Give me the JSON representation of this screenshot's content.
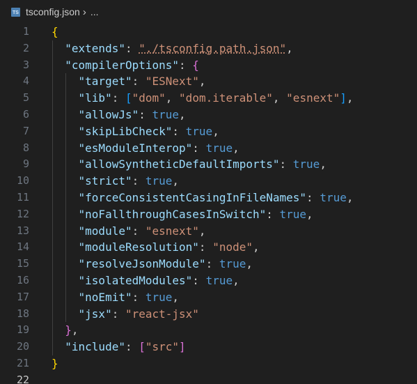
{
  "breadcrumb": {
    "icon_label": "TS",
    "file": "tsconfig.json",
    "separator": "›",
    "more": "..."
  },
  "colors": {
    "background": "#1f1f1f",
    "key": "#9cdcfe",
    "string": "#ce9178",
    "keyword": "#569cd6",
    "bracket_level1": "#ffd700",
    "bracket_level2": "#da70d6",
    "bracket_level3": "#179fff"
  },
  "lines": [
    {
      "n": "1",
      "tokens": [
        {
          "t": "{",
          "c": "b1"
        }
      ]
    },
    {
      "n": "2",
      "tokens": [
        {
          "t": "  "
        },
        {
          "t": "\"extends\"",
          "c": "key"
        },
        {
          "t": ": "
        },
        {
          "t": "\"./tsconfig.path.json\"",
          "c": "str underline"
        },
        {
          "t": ","
        }
      ]
    },
    {
      "n": "3",
      "tokens": [
        {
          "t": "  "
        },
        {
          "t": "\"compilerOptions\"",
          "c": "key"
        },
        {
          "t": ": "
        },
        {
          "t": "{",
          "c": "b2"
        }
      ]
    },
    {
      "n": "4",
      "tokens": [
        {
          "t": "    "
        },
        {
          "t": "\"target\"",
          "c": "key"
        },
        {
          "t": ": "
        },
        {
          "t": "\"ESNext\"",
          "c": "str"
        },
        {
          "t": ","
        }
      ]
    },
    {
      "n": "5",
      "tokens": [
        {
          "t": "    "
        },
        {
          "t": "\"lib\"",
          "c": "key"
        },
        {
          "t": ": "
        },
        {
          "t": "[",
          "c": "b3"
        },
        {
          "t": "\"dom\"",
          "c": "str"
        },
        {
          "t": ", "
        },
        {
          "t": "\"dom.iterable\"",
          "c": "str"
        },
        {
          "t": ", "
        },
        {
          "t": "\"esnext\"",
          "c": "str"
        },
        {
          "t": "]",
          "c": "b3"
        },
        {
          "t": ","
        }
      ]
    },
    {
      "n": "6",
      "tokens": [
        {
          "t": "    "
        },
        {
          "t": "\"allowJs\"",
          "c": "key"
        },
        {
          "t": ": "
        },
        {
          "t": "true",
          "c": "kw"
        },
        {
          "t": ","
        }
      ]
    },
    {
      "n": "7",
      "tokens": [
        {
          "t": "    "
        },
        {
          "t": "\"skipLibCheck\"",
          "c": "key"
        },
        {
          "t": ": "
        },
        {
          "t": "true",
          "c": "kw"
        },
        {
          "t": ","
        }
      ]
    },
    {
      "n": "8",
      "tokens": [
        {
          "t": "    "
        },
        {
          "t": "\"esModuleInterop\"",
          "c": "key"
        },
        {
          "t": ": "
        },
        {
          "t": "true",
          "c": "kw"
        },
        {
          "t": ","
        }
      ]
    },
    {
      "n": "9",
      "tokens": [
        {
          "t": "    "
        },
        {
          "t": "\"allowSyntheticDefaultImports\"",
          "c": "key"
        },
        {
          "t": ": "
        },
        {
          "t": "true",
          "c": "kw"
        },
        {
          "t": ","
        }
      ]
    },
    {
      "n": "10",
      "tokens": [
        {
          "t": "    "
        },
        {
          "t": "\"strict\"",
          "c": "key"
        },
        {
          "t": ": "
        },
        {
          "t": "true",
          "c": "kw"
        },
        {
          "t": ","
        }
      ]
    },
    {
      "n": "11",
      "tokens": [
        {
          "t": "    "
        },
        {
          "t": "\"forceConsistentCasingInFileNames\"",
          "c": "key"
        },
        {
          "t": ": "
        },
        {
          "t": "true",
          "c": "kw"
        },
        {
          "t": ","
        }
      ]
    },
    {
      "n": "12",
      "tokens": [
        {
          "t": "    "
        },
        {
          "t": "\"noFallthroughCasesInSwitch\"",
          "c": "key"
        },
        {
          "t": ": "
        },
        {
          "t": "true",
          "c": "kw"
        },
        {
          "t": ","
        }
      ]
    },
    {
      "n": "13",
      "tokens": [
        {
          "t": "    "
        },
        {
          "t": "\"module\"",
          "c": "key"
        },
        {
          "t": ": "
        },
        {
          "t": "\"esnext\"",
          "c": "str"
        },
        {
          "t": ","
        }
      ]
    },
    {
      "n": "14",
      "tokens": [
        {
          "t": "    "
        },
        {
          "t": "\"moduleResolution\"",
          "c": "key"
        },
        {
          "t": ": "
        },
        {
          "t": "\"node\"",
          "c": "str"
        },
        {
          "t": ","
        }
      ]
    },
    {
      "n": "15",
      "tokens": [
        {
          "t": "    "
        },
        {
          "t": "\"resolveJsonModule\"",
          "c": "key"
        },
        {
          "t": ": "
        },
        {
          "t": "true",
          "c": "kw"
        },
        {
          "t": ","
        }
      ]
    },
    {
      "n": "16",
      "tokens": [
        {
          "t": "    "
        },
        {
          "t": "\"isolatedModules\"",
          "c": "key"
        },
        {
          "t": ": "
        },
        {
          "t": "true",
          "c": "kw"
        },
        {
          "t": ","
        }
      ]
    },
    {
      "n": "17",
      "tokens": [
        {
          "t": "    "
        },
        {
          "t": "\"noEmit\"",
          "c": "key"
        },
        {
          "t": ": "
        },
        {
          "t": "true",
          "c": "kw"
        },
        {
          "t": ","
        }
      ]
    },
    {
      "n": "18",
      "tokens": [
        {
          "t": "    "
        },
        {
          "t": "\"jsx\"",
          "c": "key"
        },
        {
          "t": ": "
        },
        {
          "t": "\"react-jsx\"",
          "c": "str"
        }
      ]
    },
    {
      "n": "19",
      "tokens": [
        {
          "t": "  "
        },
        {
          "t": "}",
          "c": "b2"
        },
        {
          "t": ","
        }
      ]
    },
    {
      "n": "20",
      "tokens": [
        {
          "t": "  "
        },
        {
          "t": "\"include\"",
          "c": "key"
        },
        {
          "t": ": "
        },
        {
          "t": "[",
          "c": "b2"
        },
        {
          "t": "\"src\"",
          "c": "str"
        },
        {
          "t": "]",
          "c": "b2"
        }
      ]
    },
    {
      "n": "21",
      "tokens": [
        {
          "t": "}",
          "c": "b1"
        }
      ]
    },
    {
      "n": "22",
      "tokens": [],
      "active": true
    }
  ]
}
